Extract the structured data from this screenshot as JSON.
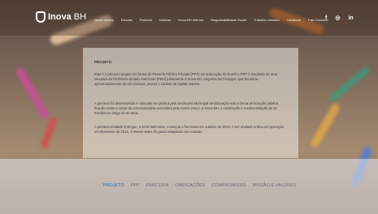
{
  "brand": {
    "name_bold": "Inova",
    "name_rest": "BH"
  },
  "nav": [
    "Quem somos",
    "Escolas",
    "Parceria",
    "Notícias",
    "Inova BH Informa",
    "Responsabilidade Social",
    "Trabalhe conosco",
    "Ouvidoria",
    "Fale Conosco"
  ],
  "social": {
    "facebook": "f",
    "instagram": "◎",
    "linkedin": "in"
  },
  "content": {
    "title": "PROJETO",
    "p1": "Este é o primeiro projeto em forma de Parceria Público Privada (PPP) em Educação do Brasil! A PPP é resultado de uma iniciativa da Prefeitura de Belo Horizonte (PBH) juntamente à Inova BH, empresa da Tramppo, que beneficia aproximadamente 25 mil crianças, jovens e adultos da capital mineira.",
    "p2": "A parceria foi desenvolvida e colocada em prática pela Secretaria Municipal de Educação sob a forma de licitação pública, ficando então a cargo da concessionária vencedora pelo menor preço, a Inova BH, a construção e a administração de 51 Escolas ao longo de 20 anos.",
    "p3": "A primeira unidade entregue, a Emei Belmonte, começou a funcionar em outubro de 2013. A 51ª unidade entrou em operação em dezembro de 2015, 3 meses antes do prazo estipulado em contrato."
  },
  "tabs": [
    "PROJETO",
    "PPP",
    "PARCERIA",
    "OBRIGAÇÕES",
    "COMPROMISSO",
    "MISSÃO E VALORES"
  ],
  "colors": {
    "active_tab": "#1a6bb8",
    "text": "#3a3a3a"
  }
}
